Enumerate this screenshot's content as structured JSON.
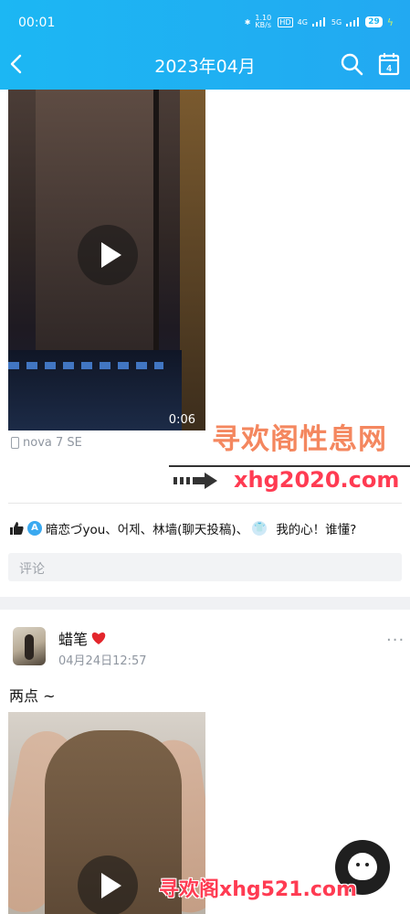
{
  "status_bar": {
    "time": "00:01",
    "net_speed": "1.10 KB/s",
    "hd": "HD",
    "net1": "4G",
    "net2": "5G",
    "battery": "29"
  },
  "header": {
    "title": "2023年04月",
    "calendar_day": "4",
    "icons": [
      "back-arrow-icon",
      "search-icon",
      "calendar-icon"
    ],
    "color": "#1cb7f3"
  },
  "post1": {
    "video_duration": "0:06",
    "device": "nova 7 SE",
    "likes_text": "暗恋づyou、어제、林墙(聊天投稿)、",
    "likes_tail": "我的心！谁懂?",
    "comment_placeholder": "评论"
  },
  "post2": {
    "username": "蜡笔",
    "date": "04月24日12:57",
    "text": "两点 ~",
    "more": "···"
  },
  "watermarks": {
    "top": "寻欢阁性息网",
    "middle": "xhg2020.com",
    "bottom": "寻欢阁xhg521.com"
  }
}
